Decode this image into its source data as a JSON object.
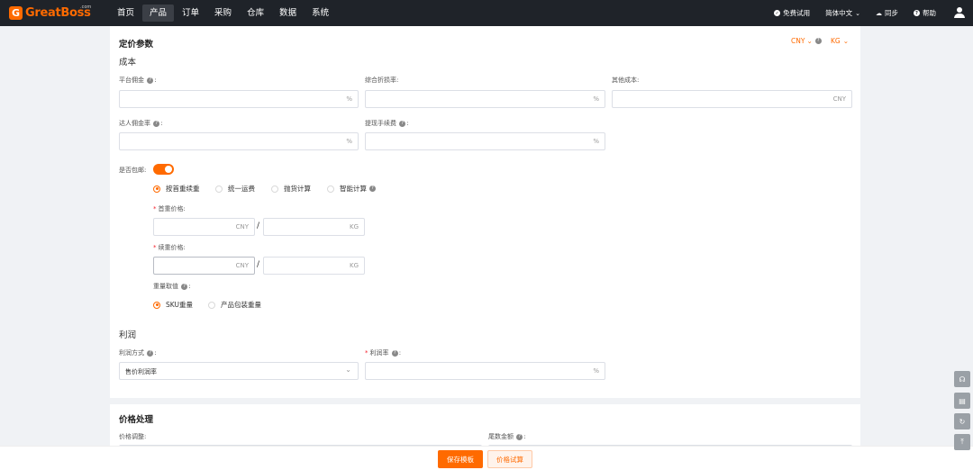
{
  "nav": {
    "logo_text": "GreatBoss",
    "logo_com": ".com",
    "menu": [
      "首页",
      "产品",
      "订单",
      "采购",
      "仓库",
      "数据",
      "系统"
    ],
    "active_index": 1,
    "free_trial": "免费试用",
    "language": "简体中文",
    "sync": "同步",
    "help": "帮助"
  },
  "pricing": {
    "title": "定价参数",
    "currency": "CNY",
    "weight_unit": "KG",
    "cost_title": "成本",
    "platform_commission": {
      "label": "平台佣金",
      "suffix": "%"
    },
    "overall_discount": {
      "label": "综合折损率:",
      "suffix": "%"
    },
    "other_cost": {
      "label": "其他成本:",
      "suffix": "CNY"
    },
    "influencer_commission": {
      "label": "达人佣金率",
      "suffix": "%"
    },
    "withdrawal_fee": {
      "label": "提现手续费",
      "suffix": "%"
    },
    "free_shipping_label": "是否包邮:",
    "shipping_methods": [
      "按首重续重",
      "统一运费",
      "抛货计算",
      "智能计算"
    ],
    "selected_shipping": 0,
    "first_weight_label": "首重价格:",
    "additional_weight_label": "续重价格:",
    "price_suffix": "CNY",
    "weight_suffix": "KG",
    "weight_value_label": "重量取值",
    "weight_options": [
      "SKU重量",
      "产品包装重量"
    ],
    "selected_weight": 0,
    "profit_title": "利润",
    "profit_method_label": "利润方式",
    "profit_method_value": "售价利润率",
    "profit_rate_label": "利润率",
    "profit_rate_suffix": "%"
  },
  "price_processing": {
    "title": "价格处理",
    "adjust_label": "价格调整:",
    "tail_label": "尾数金额"
  },
  "footer": {
    "save_label": "保存模板",
    "trial_label": "价格试算"
  },
  "side_tools": [
    "headset-icon",
    "document-icon",
    "refresh-icon",
    "back-to-top-icon"
  ]
}
